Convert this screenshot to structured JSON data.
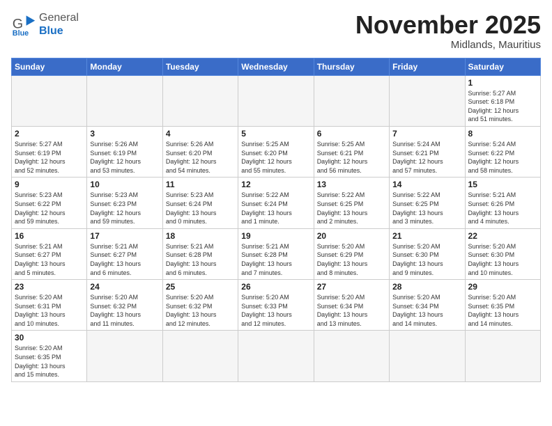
{
  "logo": {
    "general": "General",
    "blue": "Blue"
  },
  "title": "November 2025",
  "subtitle": "Midlands, Mauritius",
  "weekdays": [
    "Sunday",
    "Monday",
    "Tuesday",
    "Wednesday",
    "Thursday",
    "Friday",
    "Saturday"
  ],
  "weeks": [
    [
      {
        "day": "",
        "info": "",
        "empty": true
      },
      {
        "day": "",
        "info": "",
        "empty": true
      },
      {
        "day": "",
        "info": "",
        "empty": true
      },
      {
        "day": "",
        "info": "",
        "empty": true
      },
      {
        "day": "",
        "info": "",
        "empty": true
      },
      {
        "day": "",
        "info": "",
        "empty": true
      },
      {
        "day": "1",
        "info": "Sunrise: 5:27 AM\nSunset: 6:18 PM\nDaylight: 12 hours\nand 51 minutes."
      }
    ],
    [
      {
        "day": "2",
        "info": "Sunrise: 5:27 AM\nSunset: 6:19 PM\nDaylight: 12 hours\nand 52 minutes."
      },
      {
        "day": "3",
        "info": "Sunrise: 5:26 AM\nSunset: 6:19 PM\nDaylight: 12 hours\nand 53 minutes."
      },
      {
        "day": "4",
        "info": "Sunrise: 5:26 AM\nSunset: 6:20 PM\nDaylight: 12 hours\nand 54 minutes."
      },
      {
        "day": "5",
        "info": "Sunrise: 5:25 AM\nSunset: 6:20 PM\nDaylight: 12 hours\nand 55 minutes."
      },
      {
        "day": "6",
        "info": "Sunrise: 5:25 AM\nSunset: 6:21 PM\nDaylight: 12 hours\nand 56 minutes."
      },
      {
        "day": "7",
        "info": "Sunrise: 5:24 AM\nSunset: 6:21 PM\nDaylight: 12 hours\nand 57 minutes."
      },
      {
        "day": "8",
        "info": "Sunrise: 5:24 AM\nSunset: 6:22 PM\nDaylight: 12 hours\nand 58 minutes."
      }
    ],
    [
      {
        "day": "9",
        "info": "Sunrise: 5:23 AM\nSunset: 6:22 PM\nDaylight: 12 hours\nand 59 minutes."
      },
      {
        "day": "10",
        "info": "Sunrise: 5:23 AM\nSunset: 6:23 PM\nDaylight: 12 hours\nand 59 minutes."
      },
      {
        "day": "11",
        "info": "Sunrise: 5:23 AM\nSunset: 6:24 PM\nDaylight: 13 hours\nand 0 minutes."
      },
      {
        "day": "12",
        "info": "Sunrise: 5:22 AM\nSunset: 6:24 PM\nDaylight: 13 hours\nand 1 minute."
      },
      {
        "day": "13",
        "info": "Sunrise: 5:22 AM\nSunset: 6:25 PM\nDaylight: 13 hours\nand 2 minutes."
      },
      {
        "day": "14",
        "info": "Sunrise: 5:22 AM\nSunset: 6:25 PM\nDaylight: 13 hours\nand 3 minutes."
      },
      {
        "day": "15",
        "info": "Sunrise: 5:21 AM\nSunset: 6:26 PM\nDaylight: 13 hours\nand 4 minutes."
      }
    ],
    [
      {
        "day": "16",
        "info": "Sunrise: 5:21 AM\nSunset: 6:27 PM\nDaylight: 13 hours\nand 5 minutes."
      },
      {
        "day": "17",
        "info": "Sunrise: 5:21 AM\nSunset: 6:27 PM\nDaylight: 13 hours\nand 6 minutes."
      },
      {
        "day": "18",
        "info": "Sunrise: 5:21 AM\nSunset: 6:28 PM\nDaylight: 13 hours\nand 6 minutes."
      },
      {
        "day": "19",
        "info": "Sunrise: 5:21 AM\nSunset: 6:28 PM\nDaylight: 13 hours\nand 7 minutes."
      },
      {
        "day": "20",
        "info": "Sunrise: 5:20 AM\nSunset: 6:29 PM\nDaylight: 13 hours\nand 8 minutes."
      },
      {
        "day": "21",
        "info": "Sunrise: 5:20 AM\nSunset: 6:30 PM\nDaylight: 13 hours\nand 9 minutes."
      },
      {
        "day": "22",
        "info": "Sunrise: 5:20 AM\nSunset: 6:30 PM\nDaylight: 13 hours\nand 10 minutes."
      }
    ],
    [
      {
        "day": "23",
        "info": "Sunrise: 5:20 AM\nSunset: 6:31 PM\nDaylight: 13 hours\nand 10 minutes."
      },
      {
        "day": "24",
        "info": "Sunrise: 5:20 AM\nSunset: 6:32 PM\nDaylight: 13 hours\nand 11 minutes."
      },
      {
        "day": "25",
        "info": "Sunrise: 5:20 AM\nSunset: 6:32 PM\nDaylight: 13 hours\nand 12 minutes."
      },
      {
        "day": "26",
        "info": "Sunrise: 5:20 AM\nSunset: 6:33 PM\nDaylight: 13 hours\nand 12 minutes."
      },
      {
        "day": "27",
        "info": "Sunrise: 5:20 AM\nSunset: 6:34 PM\nDaylight: 13 hours\nand 13 minutes."
      },
      {
        "day": "28",
        "info": "Sunrise: 5:20 AM\nSunset: 6:34 PM\nDaylight: 13 hours\nand 14 minutes."
      },
      {
        "day": "29",
        "info": "Sunrise: 5:20 AM\nSunset: 6:35 PM\nDaylight: 13 hours\nand 14 minutes."
      }
    ],
    [
      {
        "day": "30",
        "info": "Sunrise: 5:20 AM\nSunset: 6:35 PM\nDaylight: 13 hours\nand 15 minutes."
      },
      {
        "day": "",
        "info": "",
        "empty": true
      },
      {
        "day": "",
        "info": "",
        "empty": true
      },
      {
        "day": "",
        "info": "",
        "empty": true
      },
      {
        "day": "",
        "info": "",
        "empty": true
      },
      {
        "day": "",
        "info": "",
        "empty": true
      },
      {
        "day": "",
        "info": "",
        "empty": true
      }
    ]
  ]
}
